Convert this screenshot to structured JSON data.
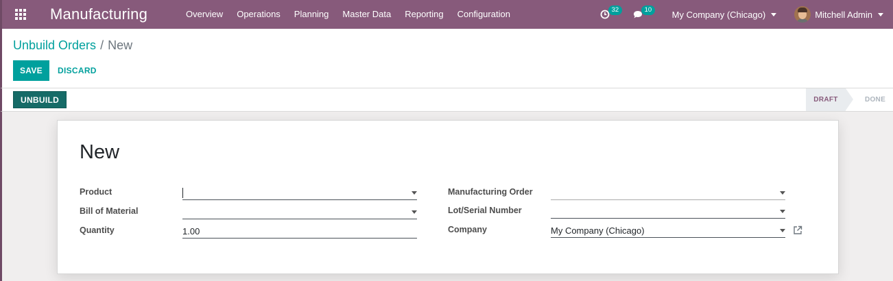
{
  "navbar": {
    "app_name": "Manufacturing",
    "menu": [
      "Overview",
      "Operations",
      "Planning",
      "Master Data",
      "Reporting",
      "Configuration"
    ],
    "activity_count": "32",
    "message_count": "10",
    "company": "My Company (Chicago)",
    "user": "Mitchell Admin"
  },
  "breadcrumb": {
    "parent": "Unbuild Orders",
    "separator": "/",
    "current": "New"
  },
  "buttons": {
    "save": "SAVE",
    "discard": "DISCARD",
    "unbuild": "UNBUILD"
  },
  "statusbar": {
    "stages": [
      "DRAFT",
      "DONE"
    ],
    "active_stage": "DRAFT"
  },
  "form": {
    "title": "New",
    "left": [
      {
        "label": "Product",
        "value": ""
      },
      {
        "label": "Bill of Material",
        "value": ""
      },
      {
        "label": "Quantity",
        "value": "1.00"
      }
    ],
    "right": [
      {
        "label": "Manufacturing Order",
        "value": ""
      },
      {
        "label": "Lot/Serial Number",
        "value": ""
      },
      {
        "label": "Company",
        "value": "My Company (Chicago)"
      }
    ]
  },
  "colors": {
    "navbar": "#875a7b",
    "primary": "#00a09d",
    "unbuild": "#166b67"
  }
}
